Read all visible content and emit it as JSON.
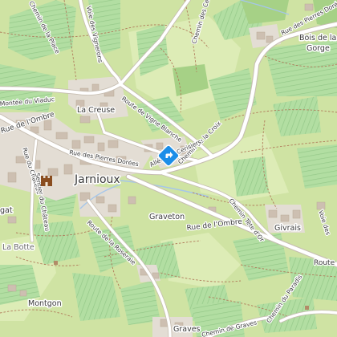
{
  "map": {
    "colors": {
      "base": "#cfe3a3",
      "meadow": "#ddecb6",
      "vineyard": "#aedd9f",
      "vine_lines": "#8fc583",
      "forest": "#a9d48a",
      "residential": "#e3ddd4",
      "building": "#cdbfb1",
      "road_fill": "#ffffff",
      "road_casing": "#c6bdb1",
      "path": "#b07a5a",
      "water": "#a5c6ea",
      "marker": "#1c8ee8"
    },
    "places": {
      "jarnioux": "Jarnioux",
      "la_creuse": "La Creuse",
      "graveton": "Graveton",
      "givrais": "Givrais",
      "bois_de_la": "Bois de la",
      "gorge": "Gorge",
      "la_botte": "La Botte",
      "montgon": "Montgon",
      "graves": "Graves",
      "gat": "gat"
    },
    "roads": {
      "rue_de_lombre_top_left": "Rue de l'Ombre",
      "rue_de_lombre_main": "Rue de l'Ombre",
      "route_right_edge": "Route c",
      "montee_du_viaduc": "Montée du Viaduc",
      "chemin_de_la_place": "Chemin de la Place",
      "voie_des_vignerons": "Voie des Vignerons",
      "chemin_des_cerisiers": "Chemin des Cerisiers",
      "rue_des_pierres_dorees_ne": "Rue des Pierres Dorées",
      "route_de_vigne_blanche": "Route de Vigne Blanche",
      "chemin_de_la_croix": "Chemin de la Croix",
      "rue_des_pierres_dorees": "Rue des Pierres Dorées",
      "allee_des_cerisiers": "Allée des Cerisiers",
      "rue_du_chateau": "Rue du Château",
      "sentier_du_chateau": "Sentier du Château",
      "route_de_la_roseraie": "Route de la Roseraie",
      "chemin_tete_dor": "Chemin Tête d'Or",
      "voie_des": "Voie des",
      "chemin_de_graves": "Chemin de Graves",
      "chemin_du_paradis": "Chemin du Paradis"
    },
    "icons": {
      "location_marker": "location-marker-icon",
      "castle": "castle-icon",
      "tiny_marker": "small-square-marker-icon"
    }
  }
}
